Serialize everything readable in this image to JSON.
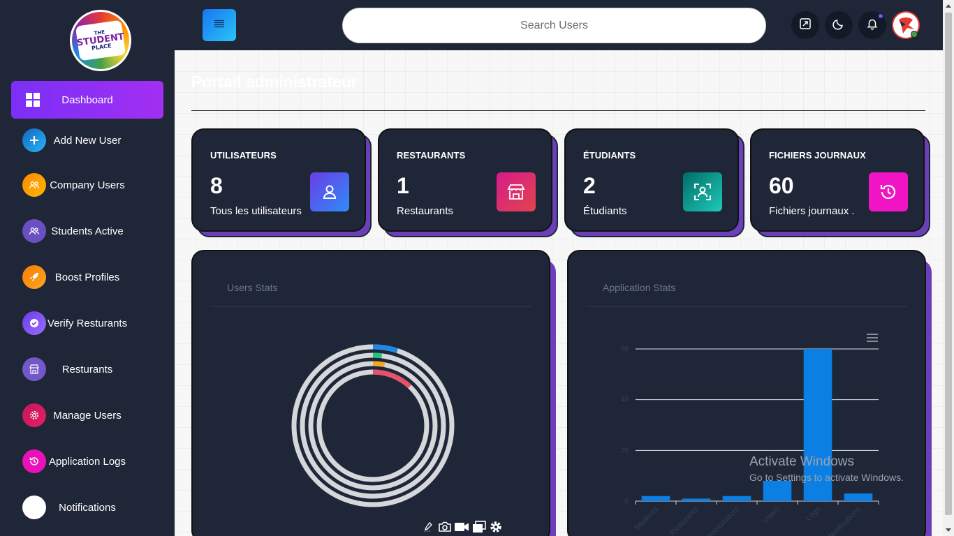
{
  "logo": {
    "line1": "THE",
    "line2": "STUDENT",
    "line3": "PLACE"
  },
  "sidebar": {
    "items": [
      {
        "label": "Dashboard",
        "icon": "grid-icon",
        "color": "#7b2ff7"
      },
      {
        "label": "Add New User",
        "icon": "plus-icon",
        "color": "#1e88e5"
      },
      {
        "label": "Company Users",
        "icon": "users-icon",
        "color": "#fb8c00"
      },
      {
        "label": "Students Active",
        "icon": "users-icon",
        "color": "#7e57c2"
      },
      {
        "label": "Boost Profiles",
        "icon": "rocket-icon",
        "color": "#f57c00"
      },
      {
        "label": "Verify Resturants",
        "icon": "check-badge-icon",
        "color": "#7c4dff"
      },
      {
        "label": "Resturants",
        "icon": "store-icon",
        "color": "#7e57c2"
      },
      {
        "label": "Manage Users",
        "icon": "gear-icon",
        "color": "#d81b60"
      },
      {
        "label": "Application Logs",
        "icon": "history-icon",
        "color": "#e91eb0"
      },
      {
        "label": "Notifications",
        "icon": "bell-icon",
        "color": "#ffffff"
      }
    ]
  },
  "header": {
    "search_placeholder": "Search Users"
  },
  "page": {
    "title": "Portail administrateur"
  },
  "stats": [
    {
      "title": "UTILISATEURS",
      "value": "8",
      "sub": "Tous les utilisateurs",
      "icon": "user-icon"
    },
    {
      "title": "RESTAURANTS",
      "value": "1",
      "sub": "Restaurants",
      "icon": "store-icon"
    },
    {
      "title": "ÉTUDIANTS",
      "value": "2",
      "sub": "Étudiants",
      "icon": "id-scan-icon"
    },
    {
      "title": "FICHIERS JOURNAUX",
      "value": "60",
      "sub": "Fichiers journaux .",
      "icon": "history-icon"
    }
  ],
  "charts": {
    "users_title": "Users Stats",
    "app_title": "Application Stats"
  },
  "chart_data": [
    {
      "type": "radialBar",
      "title": "Users Stats",
      "series": [
        {
          "value": 5,
          "color": "#1e88e5"
        },
        {
          "value": 2,
          "color": "#26c281"
        },
        {
          "value": 3,
          "color": "#f5a623"
        },
        {
          "value": 12,
          "color": "#e8506b"
        }
      ]
    },
    {
      "type": "bar",
      "title": "Application Stats",
      "categories": [
        "Students",
        "Resturants",
        "Administrators",
        "Users",
        "Logs",
        "Notifications"
      ],
      "values": [
        2,
        1,
        2,
        8,
        60,
        3
      ],
      "ylim": [
        0,
        60
      ],
      "yticks": [
        0,
        20,
        40,
        60
      ],
      "color": "#0b7fe3",
      "grid": true
    }
  ],
  "watermark": {
    "line1": "Activate Windows",
    "line2": "Go to Settings to activate Windows."
  }
}
